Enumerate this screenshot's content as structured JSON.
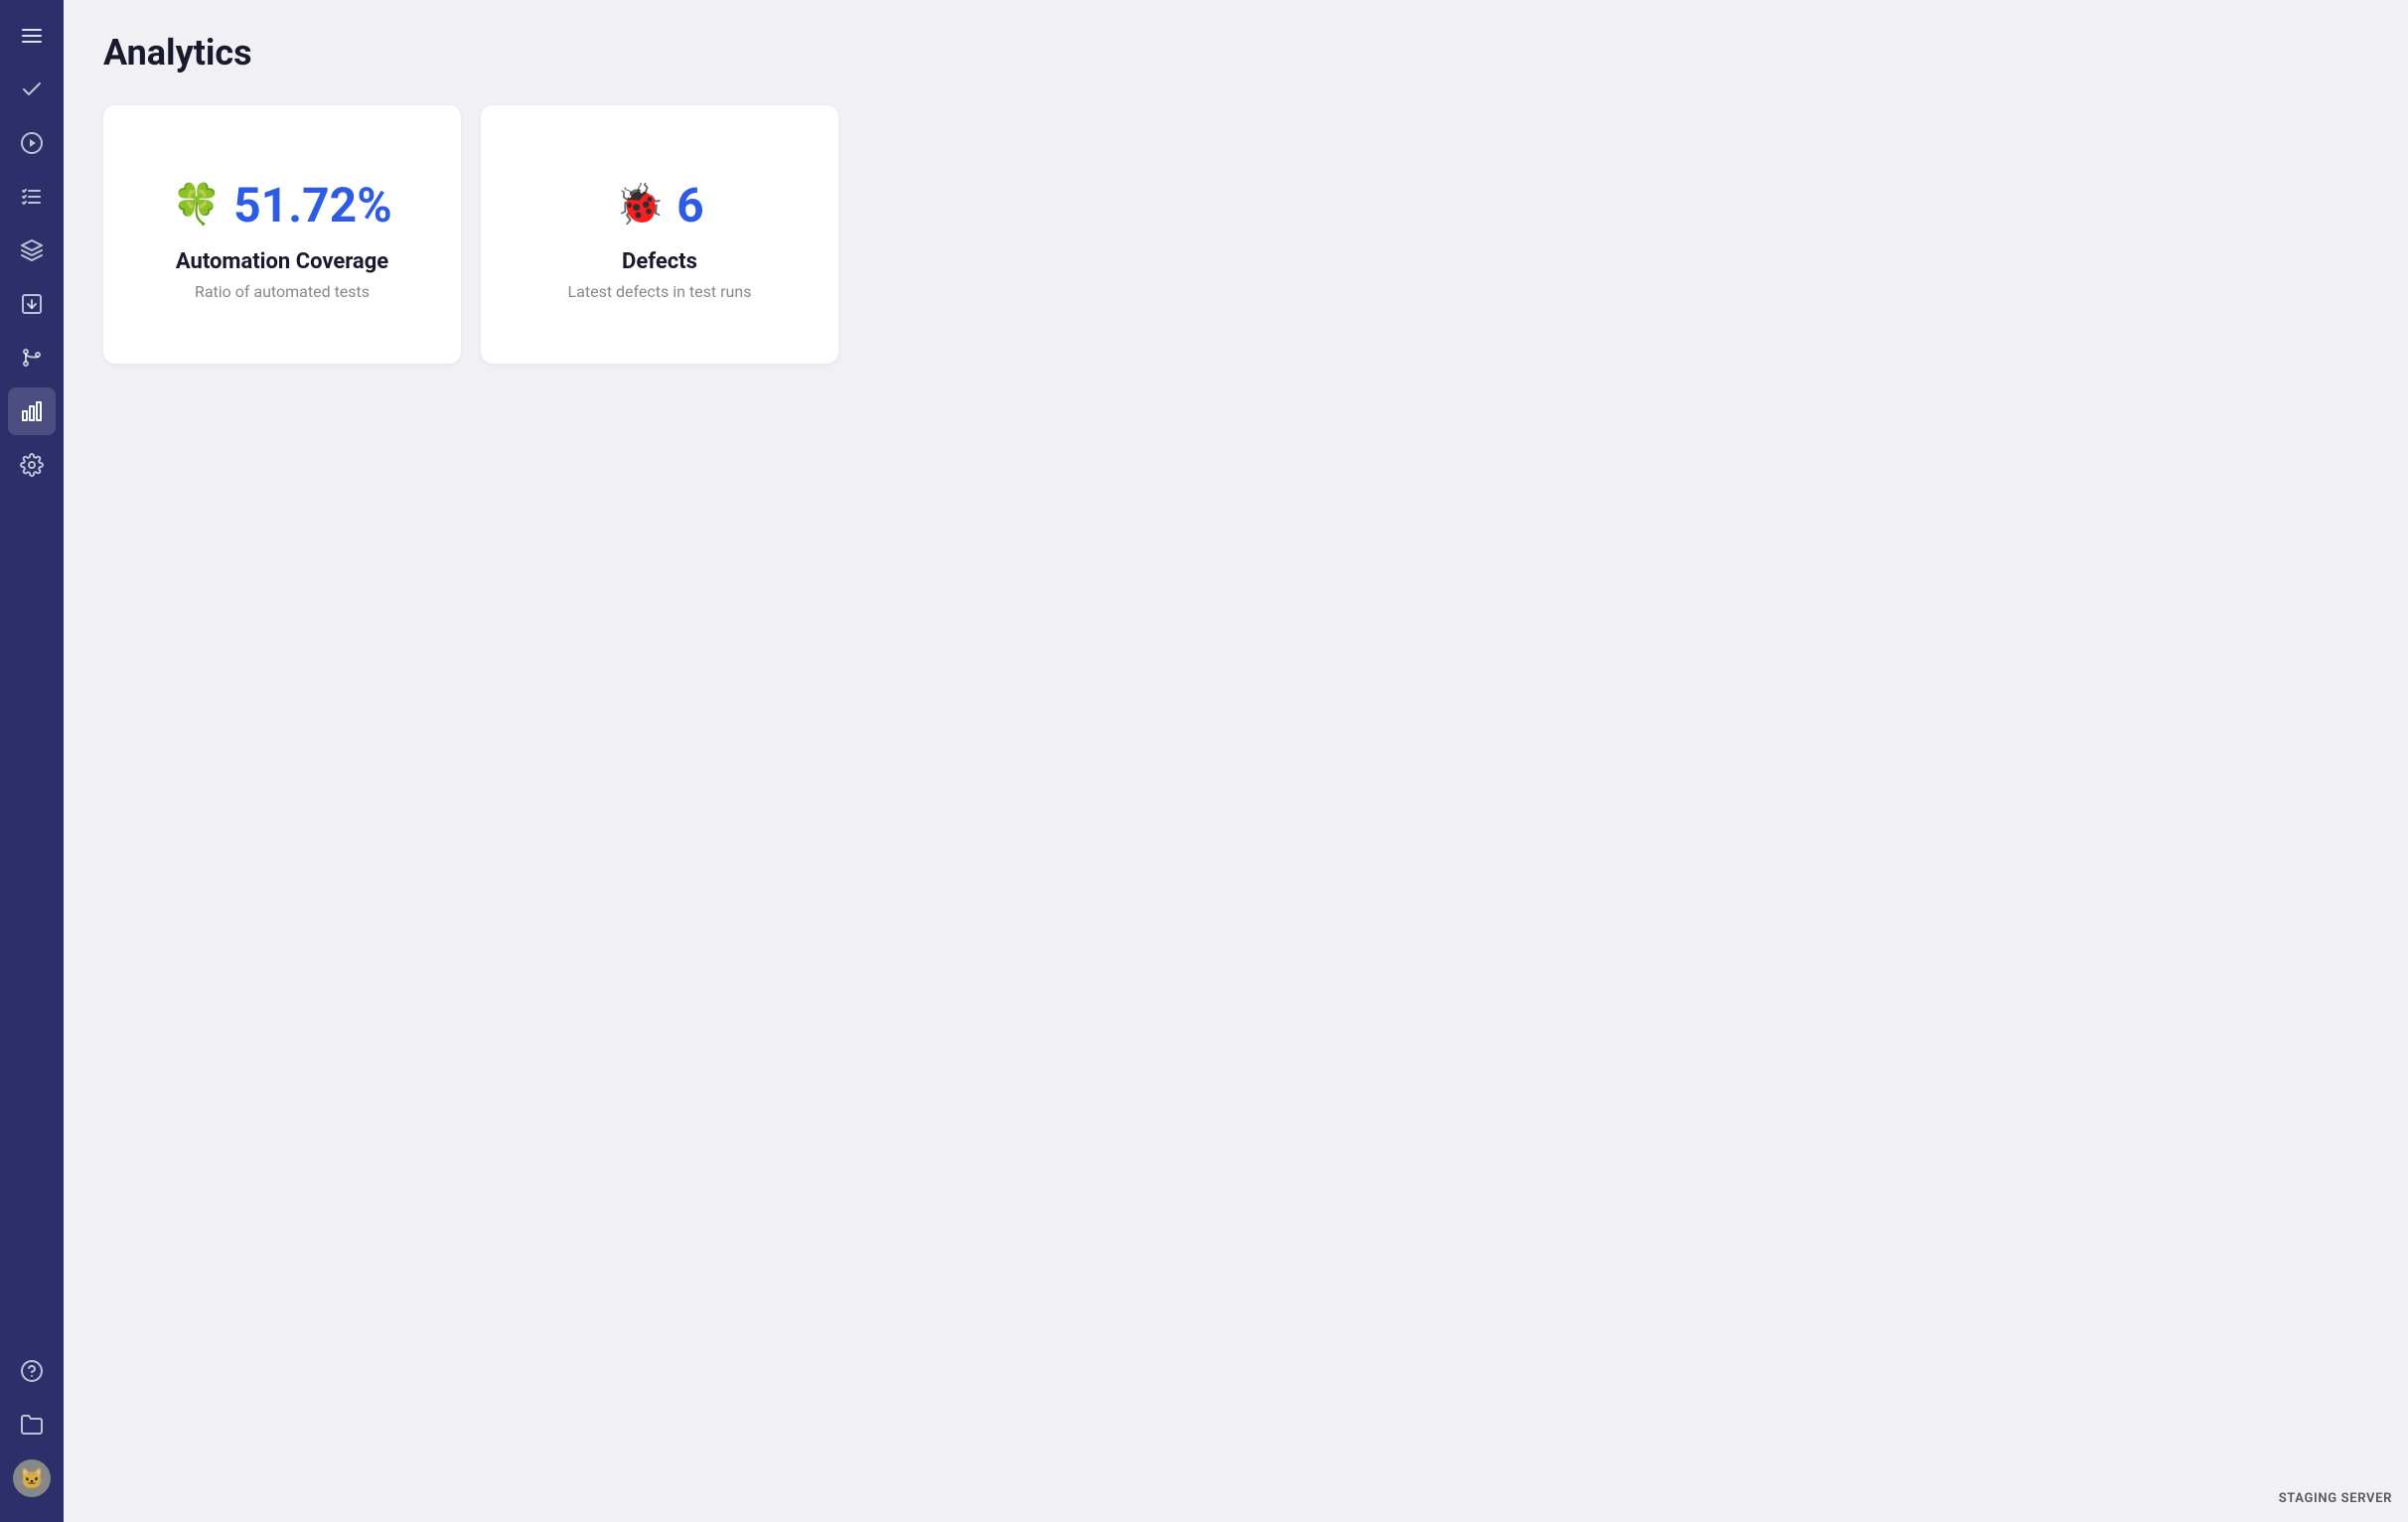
{
  "page": {
    "title": "Analytics"
  },
  "sidebar": {
    "menu_icon": "☰",
    "items": [
      {
        "id": "check",
        "label": "Check / Tests",
        "active": false
      },
      {
        "id": "play",
        "label": "Run",
        "active": false
      },
      {
        "id": "list-check",
        "label": "Test Cases",
        "active": false
      },
      {
        "id": "layers",
        "label": "Layers",
        "active": false
      },
      {
        "id": "import",
        "label": "Import",
        "active": false
      },
      {
        "id": "git",
        "label": "Git / Integrations",
        "active": false
      },
      {
        "id": "analytics",
        "label": "Analytics",
        "active": true
      },
      {
        "id": "settings",
        "label": "Settings",
        "active": false
      }
    ],
    "bottom_items": [
      {
        "id": "help",
        "label": "Help"
      },
      {
        "id": "folder",
        "label": "Folder"
      },
      {
        "id": "avatar",
        "label": "User Avatar"
      }
    ]
  },
  "cards": [
    {
      "id": "automation-coverage",
      "emoji": "🍀",
      "value": "51.72%",
      "title": "Automation Coverage",
      "subtitle": "Ratio of automated tests"
    },
    {
      "id": "defects",
      "emoji": "🐞",
      "value": "6",
      "title": "Defects",
      "subtitle": "Latest defects in test runs"
    }
  ],
  "staging_badge": "STAGING SERVER"
}
